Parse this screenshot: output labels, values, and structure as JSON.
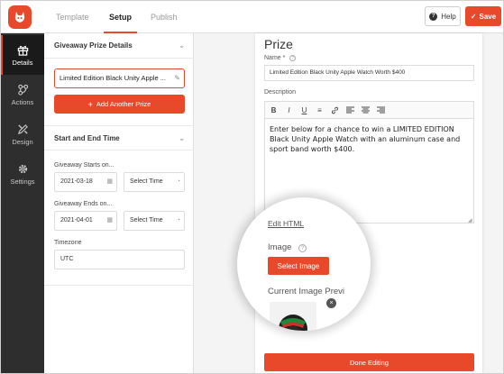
{
  "topbar": {
    "tabs": [
      "Template",
      "Setup",
      "Publish"
    ],
    "active_tab": "Setup",
    "help_label": "Help",
    "save_label": "Save"
  },
  "leftnav": {
    "items": [
      {
        "label": "Details",
        "icon": "gift-icon",
        "active": true
      },
      {
        "label": "Actions",
        "icon": "network-icon",
        "active": false
      },
      {
        "label": "Design",
        "icon": "pencil-ruler-icon",
        "active": false
      },
      {
        "label": "Settings",
        "icon": "gear-icon",
        "active": false
      }
    ]
  },
  "panel": {
    "prize_section_title": "Giveaway Prize Details",
    "prize_item": "Limited Edition Black Unity Apple ...",
    "add_prize_label": "Add Another Prize",
    "dates_section_title": "Start and End Time",
    "starts_label": "Giveaway Starts on...",
    "starts_date": "2021-03-18",
    "starts_time": "Select Time",
    "ends_label": "Giveaway Ends on...",
    "ends_date": "2021-04-01",
    "ends_time": "Select Time",
    "timezone_label": "Timezone",
    "timezone_value": "UTC"
  },
  "editor": {
    "title": "Prize",
    "name_label": "Name *",
    "name_value": "Limited Edition Black Unity Apple Watch Worth $400",
    "description_label": "Description",
    "description_text": "Enter below for a chance to win a LIMITED EDITION Black Unity Apple Watch with an aluminum case and sport band worth $400.",
    "toolbar": [
      "B",
      "I",
      "U",
      "≡",
      "link",
      "align-left",
      "align-center",
      "align-right"
    ],
    "done_label": "Done Editing"
  },
  "magnifier": {
    "edit_html": "Edit HTML",
    "image_label": "Image",
    "select_image_label": "Select Image",
    "current_image_label": "Current Image Previ"
  },
  "colors": {
    "accent": "#e8492a",
    "nav_bg": "#2e2e2e"
  }
}
